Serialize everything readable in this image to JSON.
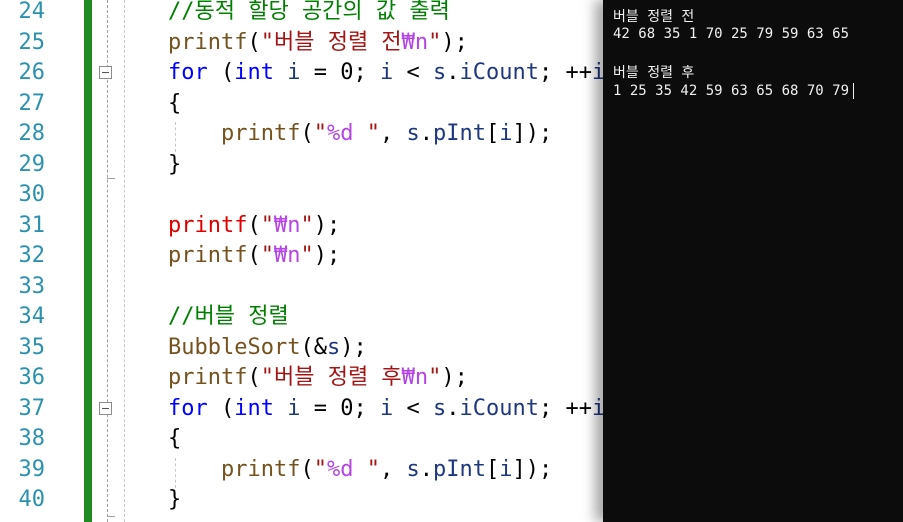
{
  "editor": {
    "lines": [
      {
        "num": "24",
        "segments": [
          {
            "t": "//동적 할당 공간의 값 출력",
            "c": "c-com"
          }
        ]
      },
      {
        "num": "25",
        "segments": [
          {
            "t": "printf",
            "c": "c-fn"
          },
          {
            "t": "(",
            "c": ""
          },
          {
            "t": "\"버블 정렬 전",
            "c": "c-str"
          },
          {
            "t": "₩n",
            "c": "c-esc"
          },
          {
            "t": "\"",
            "c": "c-str"
          },
          {
            "t": ");",
            "c": ""
          }
        ]
      },
      {
        "num": "26",
        "segments": [
          {
            "t": "for",
            "c": "c-kw"
          },
          {
            "t": " (",
            "c": ""
          },
          {
            "t": "int",
            "c": "c-kw"
          },
          {
            "t": " ",
            "c": ""
          },
          {
            "t": "i",
            "c": "c-var"
          },
          {
            "t": " = 0; ",
            "c": ""
          },
          {
            "t": "i",
            "c": "c-var"
          },
          {
            "t": " < ",
            "c": ""
          },
          {
            "t": "s",
            "c": "c-var"
          },
          {
            "t": ".",
            "c": ""
          },
          {
            "t": "iCount",
            "c": "c-mem"
          },
          {
            "t": "; ++",
            "c": ""
          },
          {
            "t": "i",
            "c": "c-var"
          },
          {
            "t": ")",
            "c": ""
          }
        ]
      },
      {
        "num": "27",
        "segments": [
          {
            "t": "{",
            "c": ""
          }
        ]
      },
      {
        "num": "28",
        "segments": [
          {
            "t": "    ",
            "c": ""
          },
          {
            "t": "printf",
            "c": "c-fn"
          },
          {
            "t": "(",
            "c": ""
          },
          {
            "t": "\"",
            "c": "c-str"
          },
          {
            "t": "%d",
            "c": "c-esc"
          },
          {
            "t": " \"",
            "c": "c-str"
          },
          {
            "t": ", ",
            "c": ""
          },
          {
            "t": "s",
            "c": "c-var"
          },
          {
            "t": ".",
            "c": ""
          },
          {
            "t": "pInt",
            "c": "c-mem"
          },
          {
            "t": "[",
            "c": ""
          },
          {
            "t": "i",
            "c": "c-var"
          },
          {
            "t": "]);",
            "c": ""
          }
        ]
      },
      {
        "num": "29",
        "segments": [
          {
            "t": "}",
            "c": ""
          }
        ]
      },
      {
        "num": "30",
        "segments": []
      },
      {
        "num": "31",
        "segments": [
          {
            "t": "printf",
            "c": "c-fnred"
          },
          {
            "t": "(",
            "c": ""
          },
          {
            "t": "\"",
            "c": "c-str"
          },
          {
            "t": "₩n",
            "c": "c-esc"
          },
          {
            "t": "\"",
            "c": "c-str"
          },
          {
            "t": ");",
            "c": ""
          }
        ]
      },
      {
        "num": "32",
        "segments": [
          {
            "t": "printf",
            "c": "c-fn"
          },
          {
            "t": "(",
            "c": ""
          },
          {
            "t": "\"",
            "c": "c-str"
          },
          {
            "t": "₩n",
            "c": "c-esc"
          },
          {
            "t": "\"",
            "c": "c-str"
          },
          {
            "t": ");",
            "c": ""
          }
        ]
      },
      {
        "num": "33",
        "segments": []
      },
      {
        "num": "34",
        "segments": [
          {
            "t": "//버블 정렬",
            "c": "c-com"
          }
        ]
      },
      {
        "num": "35",
        "segments": [
          {
            "t": "BubbleSort",
            "c": "c-fn"
          },
          {
            "t": "(&",
            "c": ""
          },
          {
            "t": "s",
            "c": "c-var"
          },
          {
            "t": ");",
            "c": ""
          }
        ]
      },
      {
        "num": "36",
        "segments": [
          {
            "t": "printf",
            "c": "c-fn"
          },
          {
            "t": "(",
            "c": ""
          },
          {
            "t": "\"버블 정렬 후",
            "c": "c-str"
          },
          {
            "t": "₩n",
            "c": "c-esc"
          },
          {
            "t": "\"",
            "c": "c-str"
          },
          {
            "t": ");",
            "c": ""
          }
        ]
      },
      {
        "num": "37",
        "segments": [
          {
            "t": "for",
            "c": "c-kw"
          },
          {
            "t": " (",
            "c": ""
          },
          {
            "t": "int",
            "c": "c-kw"
          },
          {
            "t": " ",
            "c": ""
          },
          {
            "t": "i",
            "c": "c-var"
          },
          {
            "t": " = 0; ",
            "c": ""
          },
          {
            "t": "i",
            "c": "c-var"
          },
          {
            "t": " < ",
            "c": ""
          },
          {
            "t": "s",
            "c": "c-var"
          },
          {
            "t": ".",
            "c": ""
          },
          {
            "t": "iCount",
            "c": "c-mem"
          },
          {
            "t": "; ++",
            "c": ""
          },
          {
            "t": "i",
            "c": "c-var"
          },
          {
            "t": ")",
            "c": ""
          }
        ]
      },
      {
        "num": "38",
        "segments": [
          {
            "t": "{",
            "c": ""
          }
        ]
      },
      {
        "num": "39",
        "segments": [
          {
            "t": "    ",
            "c": ""
          },
          {
            "t": "printf",
            "c": "c-fn"
          },
          {
            "t": "(",
            "c": ""
          },
          {
            "t": "\"",
            "c": "c-str"
          },
          {
            "t": "%d",
            "c": "c-esc"
          },
          {
            "t": " \"",
            "c": "c-str"
          },
          {
            "t": ", ",
            "c": ""
          },
          {
            "t": "s",
            "c": "c-var"
          },
          {
            "t": ".",
            "c": ""
          },
          {
            "t": "pInt",
            "c": "c-mem"
          },
          {
            "t": "[",
            "c": ""
          },
          {
            "t": "i",
            "c": "c-var"
          },
          {
            "t": "]);",
            "c": ""
          }
        ]
      },
      {
        "num": "40",
        "segments": [
          {
            "t": "}",
            "c": ""
          }
        ]
      }
    ]
  },
  "console": {
    "lines": [
      "버블 정렬 전",
      "42 68 35 1 70 25 79 59 63 65",
      "",
      "버블 정렬 후",
      "1 25 35 42 59 63 65 68 70 79"
    ]
  }
}
